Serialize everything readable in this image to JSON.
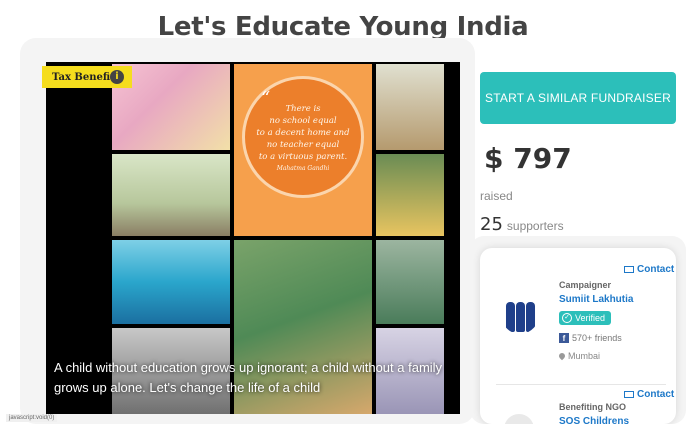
{
  "page_title": "Let's Educate Young India",
  "media": {
    "tax_badge": "Tax Benefit",
    "info_icon_glyph": "i",
    "quote_mark": "“",
    "quote_lines": [
      "There is",
      "no school equal",
      "to a decent home and",
      "no teacher equal",
      "to a virtuous parent.",
      "Mahatma Gandhi"
    ],
    "caption": "A child without education grows up ignorant; a child without a family grows up alone. Let's change the life of a child"
  },
  "cta": {
    "label": "START A SIMILAR FUNDRAISER"
  },
  "stats": {
    "amount": "$ 797",
    "raised_label": "raised",
    "supporters_count": "25",
    "supporters_label": "supporters"
  },
  "campaigner": {
    "label": "Campaigner",
    "name": "Sumiit Lakhutia",
    "verified": "Verified",
    "friends": "570+ friends",
    "location": "Mumbai",
    "contact": "Contact",
    "fb_glyph": "f",
    "check_glyph": "✓"
  },
  "ngo": {
    "label": "Benefiting NGO",
    "name": "SOS Childrens",
    "contact": "Contact"
  },
  "status_bar": {
    "url": "javascript:void(0)"
  },
  "colors": {
    "accent": "#2cbfba",
    "link": "#1d78c8",
    "badge": "#f5dd1d",
    "quote_circle": "#ec7f2b"
  }
}
